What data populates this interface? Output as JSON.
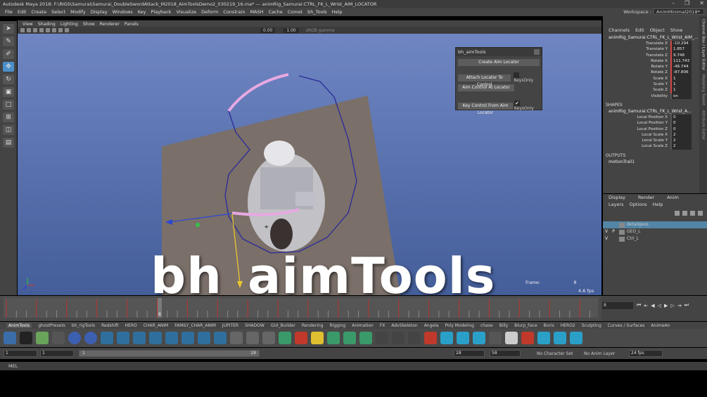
{
  "window": {
    "title": "Autodesk Maya 2018: F:\\RIGS\\Samurai\\Samurai_DoubleSwordAttack_M2018_AimToolsDemo2_030219_16.ma*  ---  animRig_Samurai:CTRL_FK_L_Wrist_AIM_LOCATOR",
    "minimize": "–",
    "maximize": "❐",
    "close": "✕"
  },
  "menu": [
    "File",
    "Edit",
    "Create",
    "Select",
    "Modify",
    "Display",
    "Windows",
    "Key",
    "Playback",
    "Visualize",
    "Deform",
    "Constrain",
    "MASH",
    "Cache",
    "Comet",
    "bh_Tools",
    "Help"
  ],
  "workspace": {
    "label": "Workspace :",
    "value": "AnimMinimal2018*"
  },
  "viewport_menu": [
    "View",
    "Shading",
    "Lighting",
    "Show",
    "Renderer",
    "Panels"
  ],
  "viewport_fields": {
    "exposure": "0.00",
    "gamma": "1.00",
    "colorspace": "sRGB gamma"
  },
  "overlay_title": "bh_aimTools",
  "hud": {
    "frame_label": "Frame:",
    "frame_value": "8",
    "fps": "4.6 fps"
  },
  "aimtools_panel": {
    "title": "bh_aimTools",
    "create_btn": "Create Aim Locator",
    "attach_btn": "Attach Locator To Control",
    "keys_only_1": "KeysOnly",
    "aim_btn": "Aim Control At Locator",
    "key_btn": "Key Control From Aim Locator",
    "keys_only_2": "KeysOnly",
    "check": "✔"
  },
  "channel_box": {
    "tabs": [
      "Channels",
      "Edit",
      "Object",
      "Show"
    ],
    "object": "animRig_Samurai:CTRL_FK_L_Wrist_AIM_...",
    "attrs": [
      {
        "name": "Translate X",
        "value": "-10.294",
        "keyed": true
      },
      {
        "name": "Translate Y",
        "value": "1.857",
        "keyed": true
      },
      {
        "name": "Translate Z",
        "value": "9.748",
        "keyed": true
      },
      {
        "name": "Rotate X",
        "value": "111.743",
        "keyed": true
      },
      {
        "name": "Rotate Y",
        "value": "-46.744",
        "keyed": true
      },
      {
        "name": "Rotate Z",
        "value": "-87.806",
        "keyed": true
      },
      {
        "name": "Scale X",
        "value": "1",
        "keyed": true
      },
      {
        "name": "Scale Y",
        "value": "1",
        "keyed": true
      },
      {
        "name": "Scale Z",
        "value": "1",
        "keyed": true
      },
      {
        "name": "Visibility",
        "value": "on",
        "keyed": false
      }
    ],
    "shapes_label": "SHAPES",
    "shape_name": "animRig_Samurai:CTRL_FK_L_Wrist_A...",
    "shape_attrs": [
      {
        "name": "Local Position X",
        "value": "0"
      },
      {
        "name": "Local Position Y",
        "value": "0"
      },
      {
        "name": "Local Position Z",
        "value": "0"
      },
      {
        "name": "Local Scale X",
        "value": "2"
      },
      {
        "name": "Local Scale Y",
        "value": "2"
      },
      {
        "name": "Local Scale Z",
        "value": "2"
      }
    ],
    "outputs_label": "OUTPUTS",
    "output_name": "motionTrail1"
  },
  "side_tabs": [
    "Channel Box / Layer Editor",
    "Modeling Toolkit",
    "Attribute Editor"
  ],
  "layers": {
    "tabs": [
      "Display",
      "Render",
      "Anim"
    ],
    "menu": [
      "Layers",
      "Options",
      "Help"
    ],
    "rows": [
      {
        "v": "",
        "p": "",
        "name": "detailgeoL",
        "selected": true
      },
      {
        "v": "V",
        "p": "P",
        "name": "GEO_L",
        "selected": false
      },
      {
        "v": "V",
        "p": "",
        "name": "Ctrl_L",
        "selected": false
      }
    ]
  },
  "timeline": {
    "current_frame_field": "8",
    "playhead_label": "8"
  },
  "shelf_tabs": [
    "AnimTools",
    "ghostPresets",
    "bh_rigTools",
    "Redshift",
    "HERO",
    "CHAR_ANIM",
    "FAMILY_CHAR_ANIM",
    "JUPITER",
    "SHADOW",
    "GUI_Builder",
    "Rendering",
    "Rigging",
    "Animation",
    "FX",
    "AdvSkeleton",
    "Angela",
    "Poly Modeling",
    "chase",
    "Billy",
    "Blurp_Face",
    "Boris",
    "HERO2",
    "Sculpting",
    "Curves / Surfaces",
    "AnimeAn"
  ],
  "range": {
    "start": "1",
    "inner_start": "1",
    "slider_start": "1",
    "slider_end": "28",
    "inner_end": "28",
    "end": "58",
    "character_set": "No Character Set",
    "anim_layer": "No Anim Layer",
    "fps": "24 fps"
  },
  "mel_label": "MEL"
}
